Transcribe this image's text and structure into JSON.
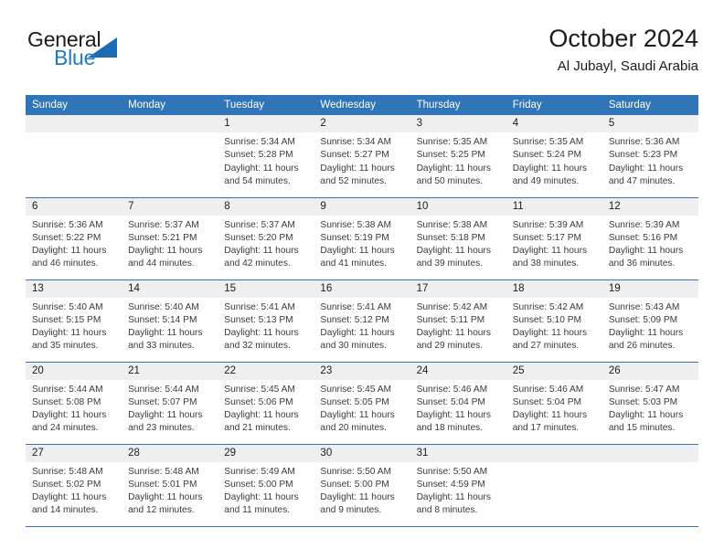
{
  "brand": {
    "name_part1": "General",
    "name_part2": "Blue",
    "triangle_color": "#1b6cb3",
    "blue_color": "#1f7bc1"
  },
  "header": {
    "title": "October 2024",
    "subtitle": "Al Jubayl, Saudi Arabia",
    "accent_color": "#3075b8"
  },
  "calendar": {
    "weekday_headers": [
      "Sunday",
      "Monday",
      "Tuesday",
      "Wednesday",
      "Thursday",
      "Friday",
      "Saturday"
    ],
    "weeks": [
      [
        {
          "day": "",
          "sunrise": "",
          "sunset": "",
          "daylight": ""
        },
        {
          "day": "",
          "sunrise": "",
          "sunset": "",
          "daylight": ""
        },
        {
          "day": "1",
          "sunrise": "Sunrise: 5:34 AM",
          "sunset": "Sunset: 5:28 PM",
          "daylight": "Daylight: 11 hours and 54 minutes."
        },
        {
          "day": "2",
          "sunrise": "Sunrise: 5:34 AM",
          "sunset": "Sunset: 5:27 PM",
          "daylight": "Daylight: 11 hours and 52 minutes."
        },
        {
          "day": "3",
          "sunrise": "Sunrise: 5:35 AM",
          "sunset": "Sunset: 5:25 PM",
          "daylight": "Daylight: 11 hours and 50 minutes."
        },
        {
          "day": "4",
          "sunrise": "Sunrise: 5:35 AM",
          "sunset": "Sunset: 5:24 PM",
          "daylight": "Daylight: 11 hours and 49 minutes."
        },
        {
          "day": "5",
          "sunrise": "Sunrise: 5:36 AM",
          "sunset": "Sunset: 5:23 PM",
          "daylight": "Daylight: 11 hours and 47 minutes."
        }
      ],
      [
        {
          "day": "6",
          "sunrise": "Sunrise: 5:36 AM",
          "sunset": "Sunset: 5:22 PM",
          "daylight": "Daylight: 11 hours and 46 minutes."
        },
        {
          "day": "7",
          "sunrise": "Sunrise: 5:37 AM",
          "sunset": "Sunset: 5:21 PM",
          "daylight": "Daylight: 11 hours and 44 minutes."
        },
        {
          "day": "8",
          "sunrise": "Sunrise: 5:37 AM",
          "sunset": "Sunset: 5:20 PM",
          "daylight": "Daylight: 11 hours and 42 minutes."
        },
        {
          "day": "9",
          "sunrise": "Sunrise: 5:38 AM",
          "sunset": "Sunset: 5:19 PM",
          "daylight": "Daylight: 11 hours and 41 minutes."
        },
        {
          "day": "10",
          "sunrise": "Sunrise: 5:38 AM",
          "sunset": "Sunset: 5:18 PM",
          "daylight": "Daylight: 11 hours and 39 minutes."
        },
        {
          "day": "11",
          "sunrise": "Sunrise: 5:39 AM",
          "sunset": "Sunset: 5:17 PM",
          "daylight": "Daylight: 11 hours and 38 minutes."
        },
        {
          "day": "12",
          "sunrise": "Sunrise: 5:39 AM",
          "sunset": "Sunset: 5:16 PM",
          "daylight": "Daylight: 11 hours and 36 minutes."
        }
      ],
      [
        {
          "day": "13",
          "sunrise": "Sunrise: 5:40 AM",
          "sunset": "Sunset: 5:15 PM",
          "daylight": "Daylight: 11 hours and 35 minutes."
        },
        {
          "day": "14",
          "sunrise": "Sunrise: 5:40 AM",
          "sunset": "Sunset: 5:14 PM",
          "daylight": "Daylight: 11 hours and 33 minutes."
        },
        {
          "day": "15",
          "sunrise": "Sunrise: 5:41 AM",
          "sunset": "Sunset: 5:13 PM",
          "daylight": "Daylight: 11 hours and 32 minutes."
        },
        {
          "day": "16",
          "sunrise": "Sunrise: 5:41 AM",
          "sunset": "Sunset: 5:12 PM",
          "daylight": "Daylight: 11 hours and 30 minutes."
        },
        {
          "day": "17",
          "sunrise": "Sunrise: 5:42 AM",
          "sunset": "Sunset: 5:11 PM",
          "daylight": "Daylight: 11 hours and 29 minutes."
        },
        {
          "day": "18",
          "sunrise": "Sunrise: 5:42 AM",
          "sunset": "Sunset: 5:10 PM",
          "daylight": "Daylight: 11 hours and 27 minutes."
        },
        {
          "day": "19",
          "sunrise": "Sunrise: 5:43 AM",
          "sunset": "Sunset: 5:09 PM",
          "daylight": "Daylight: 11 hours and 26 minutes."
        }
      ],
      [
        {
          "day": "20",
          "sunrise": "Sunrise: 5:44 AM",
          "sunset": "Sunset: 5:08 PM",
          "daylight": "Daylight: 11 hours and 24 minutes."
        },
        {
          "day": "21",
          "sunrise": "Sunrise: 5:44 AM",
          "sunset": "Sunset: 5:07 PM",
          "daylight": "Daylight: 11 hours and 23 minutes."
        },
        {
          "day": "22",
          "sunrise": "Sunrise: 5:45 AM",
          "sunset": "Sunset: 5:06 PM",
          "daylight": "Daylight: 11 hours and 21 minutes."
        },
        {
          "day": "23",
          "sunrise": "Sunrise: 5:45 AM",
          "sunset": "Sunset: 5:05 PM",
          "daylight": "Daylight: 11 hours and 20 minutes."
        },
        {
          "day": "24",
          "sunrise": "Sunrise: 5:46 AM",
          "sunset": "Sunset: 5:04 PM",
          "daylight": "Daylight: 11 hours and 18 minutes."
        },
        {
          "day": "25",
          "sunrise": "Sunrise: 5:46 AM",
          "sunset": "Sunset: 5:04 PM",
          "daylight": "Daylight: 11 hours and 17 minutes."
        },
        {
          "day": "26",
          "sunrise": "Sunrise: 5:47 AM",
          "sunset": "Sunset: 5:03 PM",
          "daylight": "Daylight: 11 hours and 15 minutes."
        }
      ],
      [
        {
          "day": "27",
          "sunrise": "Sunrise: 5:48 AM",
          "sunset": "Sunset: 5:02 PM",
          "daylight": "Daylight: 11 hours and 14 minutes."
        },
        {
          "day": "28",
          "sunrise": "Sunrise: 5:48 AM",
          "sunset": "Sunset: 5:01 PM",
          "daylight": "Daylight: 11 hours and 12 minutes."
        },
        {
          "day": "29",
          "sunrise": "Sunrise: 5:49 AM",
          "sunset": "Sunset: 5:00 PM",
          "daylight": "Daylight: 11 hours and 11 minutes."
        },
        {
          "day": "30",
          "sunrise": "Sunrise: 5:50 AM",
          "sunset": "Sunset: 5:00 PM",
          "daylight": "Daylight: 11 hours and 9 minutes."
        },
        {
          "day": "31",
          "sunrise": "Sunrise: 5:50 AM",
          "sunset": "Sunset: 4:59 PM",
          "daylight": "Daylight: 11 hours and 8 minutes."
        },
        {
          "day": "",
          "sunrise": "",
          "sunset": "",
          "daylight": ""
        },
        {
          "day": "",
          "sunrise": "",
          "sunset": "",
          "daylight": ""
        }
      ]
    ]
  }
}
